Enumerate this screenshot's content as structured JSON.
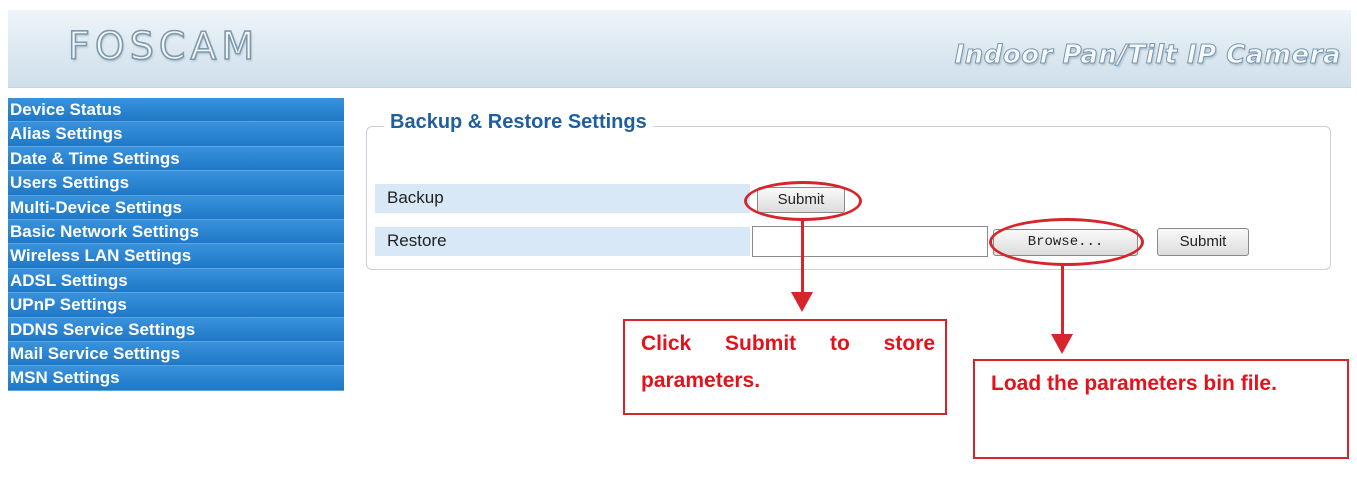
{
  "header": {
    "logo": "FOSCAM",
    "product_title": "Indoor Pan/Tilt IP Camera"
  },
  "sidebar": {
    "items": [
      {
        "label": "Device Status"
      },
      {
        "label": "Alias Settings"
      },
      {
        "label": "Date & Time Settings"
      },
      {
        "label": "Users Settings"
      },
      {
        "label": "Multi-Device Settings"
      },
      {
        "label": "Basic Network Settings"
      },
      {
        "label": "Wireless LAN Settings"
      },
      {
        "label": "ADSL Settings"
      },
      {
        "label": "UPnP Settings"
      },
      {
        "label": "DDNS Service Settings"
      },
      {
        "label": "Mail Service Settings"
      },
      {
        "label": "MSN Settings"
      }
    ]
  },
  "panel": {
    "title": "Backup & Restore Settings",
    "backup": {
      "label": "Backup",
      "submit_label": "Submit"
    },
    "restore": {
      "label": "Restore",
      "file_value": "",
      "browse_label": "Browse...",
      "submit_label": "Submit"
    }
  },
  "annotations": {
    "backup_note": "Click Submit to store parameters.",
    "restore_note": "Load the parameters bin file.",
    "color": "#d6262b"
  },
  "colors": {
    "sidebar_bg": "#2b83cf",
    "panel_title": "#1f5f9e",
    "row_bg": "#d8e8f7"
  }
}
